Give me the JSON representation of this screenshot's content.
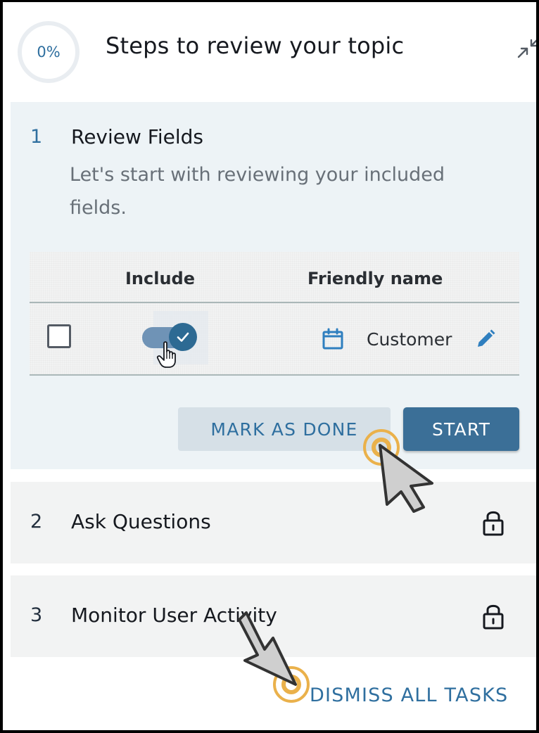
{
  "header": {
    "progress": "0%",
    "title": "Steps to review your topic",
    "collapse_icon": "collapse-arrows-icon"
  },
  "steps": [
    {
      "number": "1",
      "title": "Review Fields",
      "description": "Let's start with reviewing your included fields.",
      "state": "active",
      "table": {
        "columns": [
          "Include",
          "Friendly name"
        ],
        "rows": [
          {
            "selected": false,
            "include": true,
            "field_icon": "calendar-icon",
            "friendly_name": "Customer",
            "edit_icon": "pencil-icon"
          }
        ]
      },
      "actions": {
        "mark_done": "MARK AS DONE",
        "start": "START"
      }
    },
    {
      "number": "2",
      "title": "Ask Questions",
      "state": "locked",
      "icon": "lock-icon"
    },
    {
      "number": "3",
      "title": "Monitor User Activity",
      "state": "locked",
      "icon": "lock-icon"
    }
  ],
  "footer": {
    "dismiss": "DISMISS ALL TASKS"
  },
  "colors": {
    "accent": "#2f6f9f",
    "primary_button": "#3b6f97",
    "active_step_bg": "#edf3f6",
    "locked_step_bg": "#f2f3f3",
    "click_highlight": "#eab14b"
  }
}
